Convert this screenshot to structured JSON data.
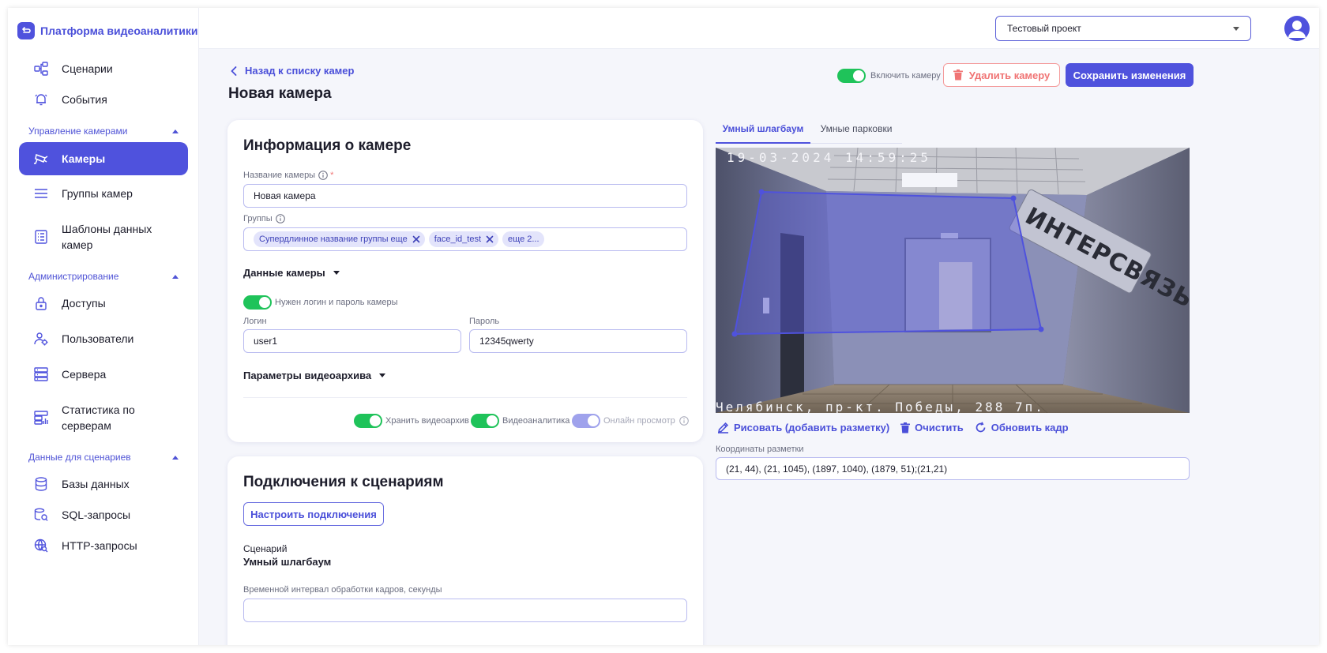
{
  "app": {
    "title": "Платформа видеоаналитики"
  },
  "sidebar": {
    "items_top": [
      {
        "label": "Сценарии",
        "icon": "scenarios-icon"
      },
      {
        "label": "События",
        "icon": "bell-icon"
      }
    ],
    "groups": [
      {
        "label": "Управление камерами",
        "items": [
          {
            "label": "Камеры",
            "icon": "camera-icon",
            "active": true
          },
          {
            "label": "Группы камер",
            "icon": "list-icon"
          },
          {
            "label": "Шаблоны данных камер",
            "icon": "template-icon"
          }
        ]
      },
      {
        "label": "Администрирование",
        "items": [
          {
            "label": "Доступы",
            "icon": "lock-icon"
          },
          {
            "label": "Пользователи",
            "icon": "users-icon"
          },
          {
            "label": "Сервера",
            "icon": "server-icon"
          },
          {
            "label": "Статистика по серверам",
            "icon": "server-stats-icon"
          }
        ]
      },
      {
        "label": "Данные для сценариев",
        "items": [
          {
            "label": "Базы данных",
            "icon": "database-icon"
          },
          {
            "label": "SQL-запросы",
            "icon": "sql-search-icon"
          },
          {
            "label": "HTTP-запросы",
            "icon": "globe-search-icon"
          }
        ]
      }
    ]
  },
  "header": {
    "project": "Тестовый проект"
  },
  "page": {
    "back_label": "Назад к списку камер",
    "title": "Новая камера",
    "enable_label": "Включить камеру",
    "delete_label": "Удалить камеру",
    "save_label": "Сохранить изменения"
  },
  "camera_info": {
    "title": "Информация о камере",
    "name_label": "Название камеры",
    "name_required": "*",
    "name_value": "Новая камера",
    "groups_label": "Группы",
    "groups": [
      "Супердлинное название группы еще",
      "face_id_test"
    ],
    "groups_more": "еще 2...",
    "camera_data_label": "Данные камеры",
    "auth_toggle_label": "Нужен логин и пароль камеры",
    "login_label": "Логин",
    "login_value": "user1",
    "password_label": "Пароль",
    "password_value": "12345qwerty",
    "archive_params_label": "Параметры видеоархива",
    "switches": {
      "store": "Хранить видеоархив",
      "analytics": "Видеоаналитика",
      "online": "Онлайн просмотр"
    }
  },
  "connections": {
    "title": "Подключения к сценариям",
    "configure_label": "Настроить подключения",
    "scenario_label": "Сценарий",
    "scenario_value": "Умный шлагбаум",
    "interval_label": "Временной интервал обработки кадров, секунды"
  },
  "markup": {
    "tabs": [
      "Умный шлагбаум",
      "Умные парковки"
    ],
    "timestamp": "19-03-2024 14:59:25",
    "location_caption": "Челябинск, пр-кт. Победы, 288 7п.",
    "draw_label": "Рисовать (добавить разметку)",
    "clear_label": "Очистить",
    "refresh_label": "Обновить кадр",
    "coords_label": "Координаты разметки",
    "coords_value": "(21, 44), (21, 1045), (1897, 1040), (1879, 51);(21,21)"
  },
  "colors": {
    "accent": "#4f52dd",
    "success": "#1fc35a",
    "danger": "#f07474"
  }
}
